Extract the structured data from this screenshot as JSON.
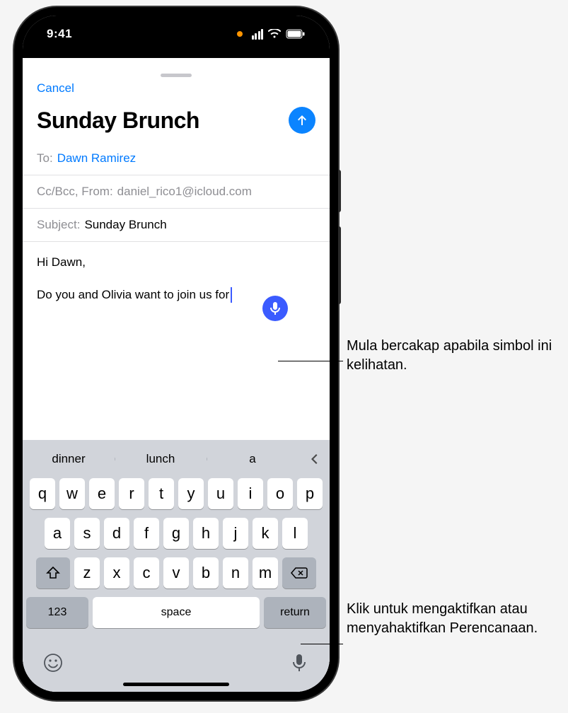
{
  "status": {
    "time": "9:41"
  },
  "sheet": {
    "cancel": "Cancel",
    "title": "Sunday Brunch",
    "to_label": "To:",
    "to_value": "Dawn Ramirez",
    "ccbcc_label": "Cc/Bcc, From:",
    "from_value": "daniel_rico1@icloud.com",
    "subject_label": "Subject:",
    "subject_value": "Sunday Brunch"
  },
  "body": {
    "line1": "Hi Dawn,",
    "line2": "Do you and Olivia want to join us for"
  },
  "keyboard": {
    "predictions": [
      "dinner",
      "lunch",
      "a"
    ],
    "row1": [
      "q",
      "w",
      "e",
      "r",
      "t",
      "y",
      "u",
      "i",
      "o",
      "p"
    ],
    "row2": [
      "a",
      "s",
      "d",
      "f",
      "g",
      "h",
      "j",
      "k",
      "l"
    ],
    "row3": [
      "z",
      "x",
      "c",
      "v",
      "b",
      "n",
      "m"
    ],
    "num_label": "123",
    "space_label": "space",
    "return_label": "return"
  },
  "callouts": {
    "mic_bubble": "Mula bercakap apabila simbol ini kelihatan.",
    "mic_keyboard": "Klik untuk mengaktifkan atau menyahaktifkan Perencanaan."
  }
}
